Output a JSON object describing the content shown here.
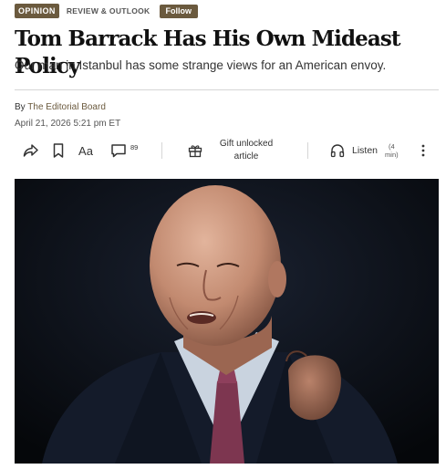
{
  "header": {
    "badge": "OPINION",
    "section": "REVIEW & OUTLOOK",
    "follow_label": "Follow"
  },
  "article": {
    "headline": "Tom Barrack Has His Own Mideast Policy",
    "subhead": "Our man in Istanbul has some strange views for an American envoy.",
    "byline_prefix": "By ",
    "byline_author": "The Editorial Board",
    "timestamp": "April 21, 2026 5:21 pm ET"
  },
  "toolbar": {
    "share_icon": "share-icon",
    "bookmark_icon": "bookmark-icon",
    "text_size_label": "Aa",
    "comments_count": "89",
    "gift_label": "Gift unlocked article",
    "gift_line1": "Gift unlocked",
    "gift_line2": "article",
    "listen_label": "Listen",
    "listen_duration_line1": "(4",
    "listen_duration_line2": "min)"
  },
  "colors": {
    "accent": "#6b5a3e",
    "text": "#111111",
    "divider": "#d6d6d6",
    "photo_background": "#0a0d12"
  }
}
